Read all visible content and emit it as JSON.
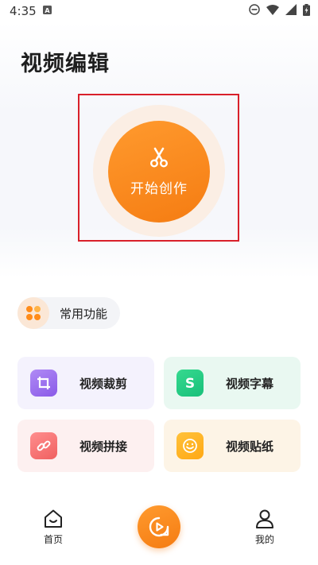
{
  "status_bar": {
    "time": "4:35"
  },
  "header": {
    "title": "视频编辑"
  },
  "hero": {
    "create_label": "开始创作"
  },
  "section": {
    "label": "常用功能"
  },
  "features": [
    {
      "label": "视频裁剪",
      "icon": "crop-icon"
    },
    {
      "label": "视频字幕",
      "icon": "subtitle-icon"
    },
    {
      "label": "视频拼接",
      "icon": "link-icon"
    },
    {
      "label": "视频贴纸",
      "icon": "smiley-icon"
    }
  ],
  "bottom_nav": {
    "home_label": "首页",
    "mine_label": "我的"
  },
  "colors": {
    "accent": "#f57c12",
    "highlight": "#d9202a"
  }
}
